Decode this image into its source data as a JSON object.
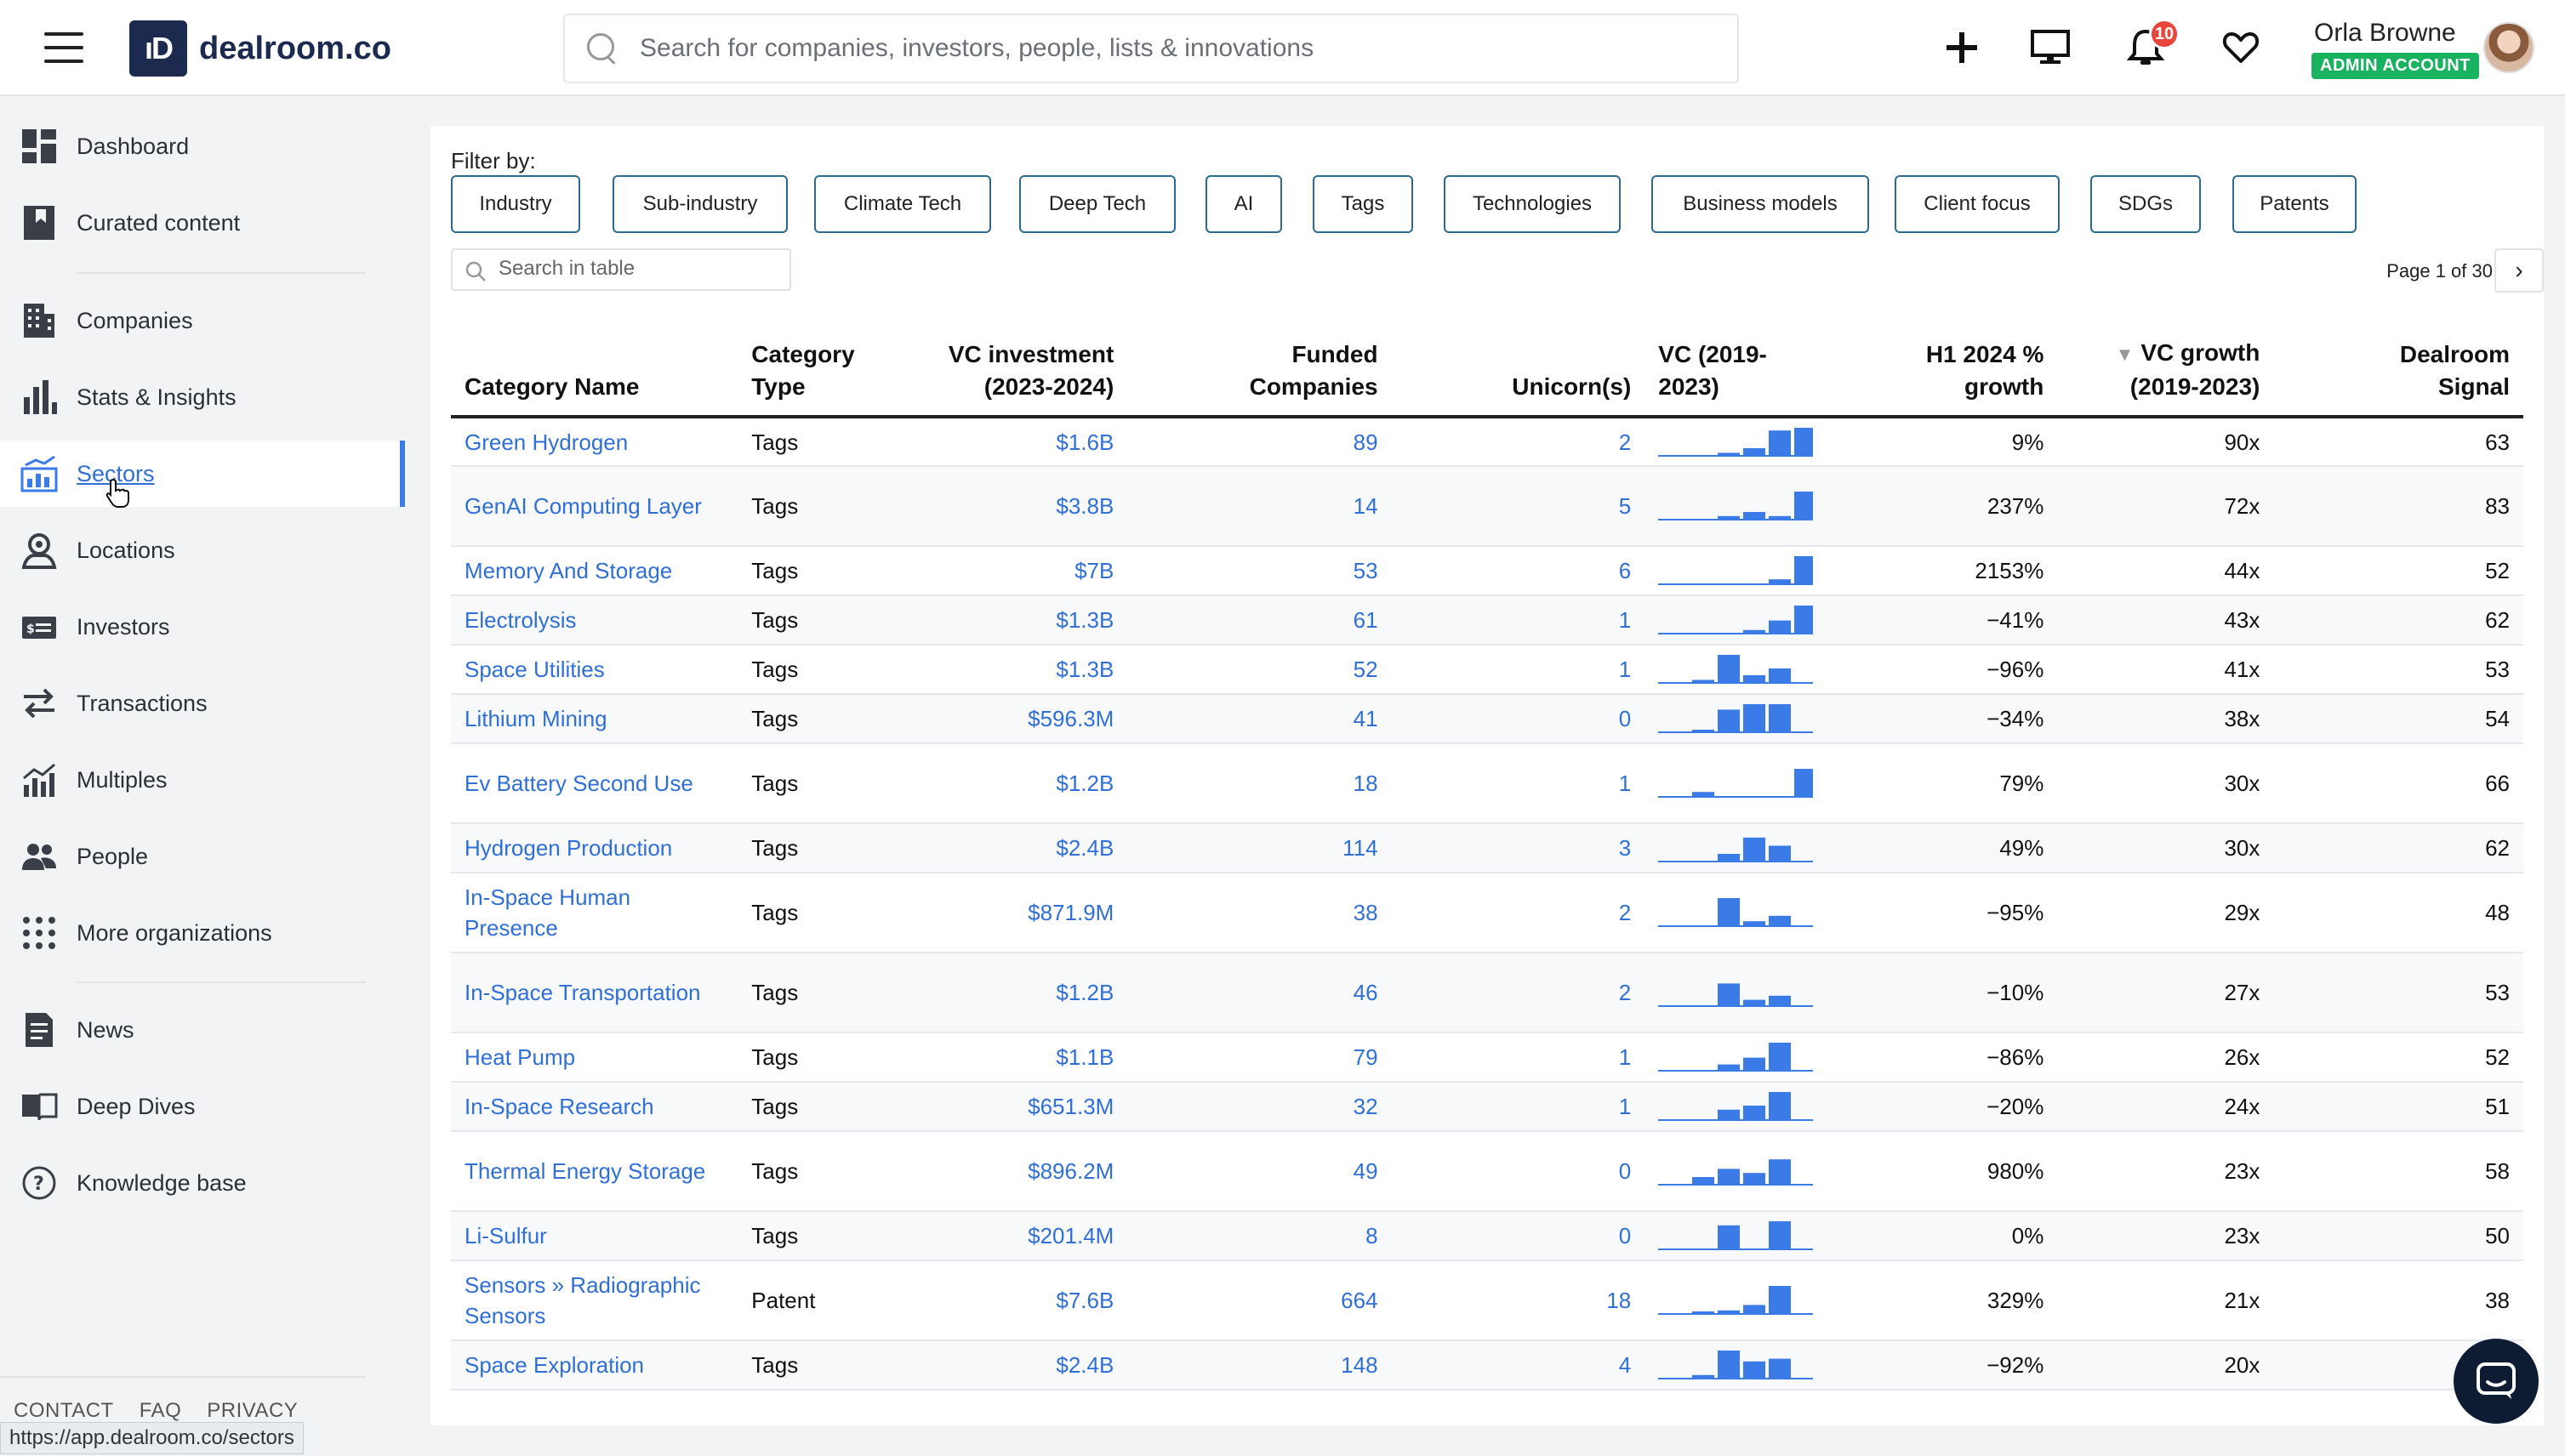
{
  "header": {
    "logo_mark": "ıD",
    "logo_text": "dealroom.co",
    "search_placeholder": "Search for companies, investors, people, lists & innovations",
    "notifications_count": "10",
    "user_name": "Orla Browne",
    "account_badge": "ADMIN ACCOUNT",
    "icons": [
      "menu-icon",
      "plus-icon",
      "monitor-icon",
      "bell-icon",
      "heart-icon"
    ]
  },
  "sidebar": {
    "items": [
      {
        "label": "Dashboard",
        "icon": "dashboard-icon"
      },
      {
        "label": "Curated content",
        "icon": "bookmark-icon"
      },
      {
        "label": "Companies",
        "icon": "building-icon"
      },
      {
        "label": "Stats & Insights",
        "icon": "bar-chart-icon"
      },
      {
        "label": "Sectors",
        "icon": "sectors-icon"
      },
      {
        "label": "Locations",
        "icon": "location-icon"
      },
      {
        "label": "Investors",
        "icon": "investors-icon"
      },
      {
        "label": "Transactions",
        "icon": "transactions-icon"
      },
      {
        "label": "Multiples",
        "icon": "multiples-icon"
      },
      {
        "label": "People",
        "icon": "people-icon"
      },
      {
        "label": "More organizations",
        "icon": "grid-icon"
      },
      {
        "label": "News",
        "icon": "news-icon"
      },
      {
        "label": "Deep Dives",
        "icon": "book-icon"
      },
      {
        "label": "Knowledge base",
        "icon": "help-icon"
      }
    ],
    "active": "Sectors",
    "footer": {
      "contact": "CONTACT",
      "faq": "FAQ",
      "privacy": "PRIVACY"
    },
    "status_url": "https://app.dealroom.co/sectors"
  },
  "filters": {
    "label": "Filter by:",
    "buttons": [
      "Industry",
      "Sub-industry",
      "Climate Tech",
      "Deep Tech",
      "AI",
      "Tags",
      "Technologies",
      "Business models",
      "Client focus",
      "SDGs",
      "Patents"
    ]
  },
  "table_search_placeholder": "Search in table",
  "pager": {
    "text": "Page 1 of 30",
    "next": "›"
  },
  "table": {
    "headers": {
      "name": "Category Name",
      "type_1": "Category",
      "type_2": "Type",
      "vc_inv_1": "VC investment",
      "vc_inv_2": "(2023-2024)",
      "funded_1": "Funded",
      "funded_2": "Companies",
      "unicorns": "Unicorn(s)",
      "vc_hist_1": "VC (2019-",
      "vc_hist_2": "2023)",
      "h1_1": "H1 2024 %",
      "h1_2": "growth",
      "growth_1": "VC growth",
      "growth_2": "(2019-2023)",
      "signal_1": "Dealroom",
      "signal_2": "Signal"
    },
    "sort_indicator": "▼",
    "rows": [
      {
        "name": "Green Hydrogen",
        "type": "Tags",
        "vc_investment": "$1.6B",
        "funded": "89",
        "unicorns": "2",
        "spark": [
          0,
          0,
          0.08,
          0.25,
          0.9,
          1
        ],
        "h1_growth": "9%",
        "vc_growth": "90x",
        "signal": "63"
      },
      {
        "name": "GenAI Computing Layer",
        "type": "Tags",
        "vc_investment": "$3.8B",
        "funded": "14",
        "unicorns": "5",
        "spark": [
          0,
          0,
          0.1,
          0.25,
          0.1,
          1
        ],
        "h1_growth": "237%",
        "vc_growth": "72x",
        "signal": "83"
      },
      {
        "name": "Memory And Storage",
        "type": "Tags",
        "vc_investment": "$7B",
        "funded": "53",
        "unicorns": "6",
        "spark": [
          0,
          0,
          0,
          0,
          0.15,
          1
        ],
        "h1_growth": "2153%",
        "vc_growth": "44x",
        "signal": "52"
      },
      {
        "name": "Electrolysis",
        "type": "Tags",
        "vc_investment": "$1.3B",
        "funded": "61",
        "unicorns": "1",
        "spark": [
          0,
          0,
          0,
          0.1,
          0.45,
          1
        ],
        "h1_growth": "−41%",
        "vc_growth": "43x",
        "signal": "62"
      },
      {
        "name": "Space Utilities",
        "type": "Tags",
        "vc_investment": "$1.3B",
        "funded": "52",
        "unicorns": "1",
        "spark": [
          0,
          0.08,
          1,
          0.25,
          0.5,
          0
        ],
        "h1_growth": "−96%",
        "vc_growth": "41x",
        "signal": "53"
      },
      {
        "name": "Lithium Mining",
        "type": "Tags",
        "vc_investment": "$596.3M",
        "funded": "41",
        "unicorns": "0",
        "spark": [
          0,
          0.05,
          0.8,
          1,
          1,
          0
        ],
        "h1_growth": "−34%",
        "vc_growth": "38x",
        "signal": "54"
      },
      {
        "name": "Ev Battery Second Use",
        "type": "Tags",
        "vc_investment": "$1.2B",
        "funded": "18",
        "unicorns": "1",
        "spark": [
          0,
          0.15,
          0,
          0,
          0,
          1
        ],
        "h1_growth": "79%",
        "vc_growth": "30x",
        "signal": "66"
      },
      {
        "name": "Hydrogen Production",
        "type": "Tags",
        "vc_investment": "$2.4B",
        "funded": "114",
        "unicorns": "3",
        "spark": [
          0,
          0,
          0.25,
          0.85,
          0.55,
          0
        ],
        "h1_growth": "49%",
        "vc_growth": "30x",
        "signal": "62"
      },
      {
        "name": "In-Space Human Presence",
        "type": "Tags",
        "vc_investment": "$871.9M",
        "funded": "38",
        "unicorns": "2",
        "spark": [
          0,
          0,
          1,
          0.15,
          0.35,
          0
        ],
        "h1_growth": "−95%",
        "vc_growth": "29x",
        "signal": "48"
      },
      {
        "name": "In-Space Transportation",
        "type": "Tags",
        "vc_investment": "$1.2B",
        "funded": "46",
        "unicorns": "2",
        "spark": [
          0,
          0,
          0.8,
          0.2,
          0.35,
          0
        ],
        "h1_growth": "−10%",
        "vc_growth": "27x",
        "signal": "53"
      },
      {
        "name": "Heat Pump",
        "type": "Tags",
        "vc_investment": "$1.1B",
        "funded": "79",
        "unicorns": "1",
        "spark": [
          0,
          0,
          0.2,
          0.45,
          1,
          0
        ],
        "h1_growth": "−86%",
        "vc_growth": "26x",
        "signal": "52"
      },
      {
        "name": "In-Space Research",
        "type": "Tags",
        "vc_investment": "$651.3M",
        "funded": "32",
        "unicorns": "1",
        "spark": [
          0,
          0,
          0.35,
          0.5,
          1,
          0
        ],
        "h1_growth": "−20%",
        "vc_growth": "24x",
        "signal": "51"
      },
      {
        "name": "Thermal Energy Storage",
        "type": "Tags",
        "vc_investment": "$896.2M",
        "funded": "49",
        "unicorns": "0",
        "spark": [
          0,
          0.25,
          0.55,
          0.4,
          0.9,
          0
        ],
        "h1_growth": "980%",
        "vc_growth": "23x",
        "signal": "58"
      },
      {
        "name": "Li-Sulfur",
        "type": "Tags",
        "vc_investment": "$201.4M",
        "funded": "8",
        "unicorns": "0",
        "spark": [
          0,
          0,
          0.85,
          0,
          1,
          0
        ],
        "h1_growth": "0%",
        "vc_growth": "23x",
        "signal": "50"
      },
      {
        "name": "Sensors » Radiographic Sensors",
        "type": "Patent",
        "vc_investment": "$7.6B",
        "funded": "664",
        "unicorns": "18",
        "spark": [
          0,
          0.05,
          0.1,
          0.3,
          1,
          0
        ],
        "h1_growth": "329%",
        "vc_growth": "21x",
        "signal": "38"
      },
      {
        "name": "Space Exploration",
        "type": "Tags",
        "vc_investment": "$2.4B",
        "funded": "148",
        "unicorns": "4",
        "spark": [
          0,
          0.1,
          1,
          0.6,
          0.7,
          0
        ],
        "h1_growth": "−92%",
        "vc_growth": "20x",
        "signal": "-"
      }
    ]
  },
  "colors": {
    "accent": "#2f6fd6",
    "spark": "#3a7be8",
    "badge_green": "#19b25f",
    "badge_red": "#e8453c",
    "logo": "#1b2a4e"
  }
}
